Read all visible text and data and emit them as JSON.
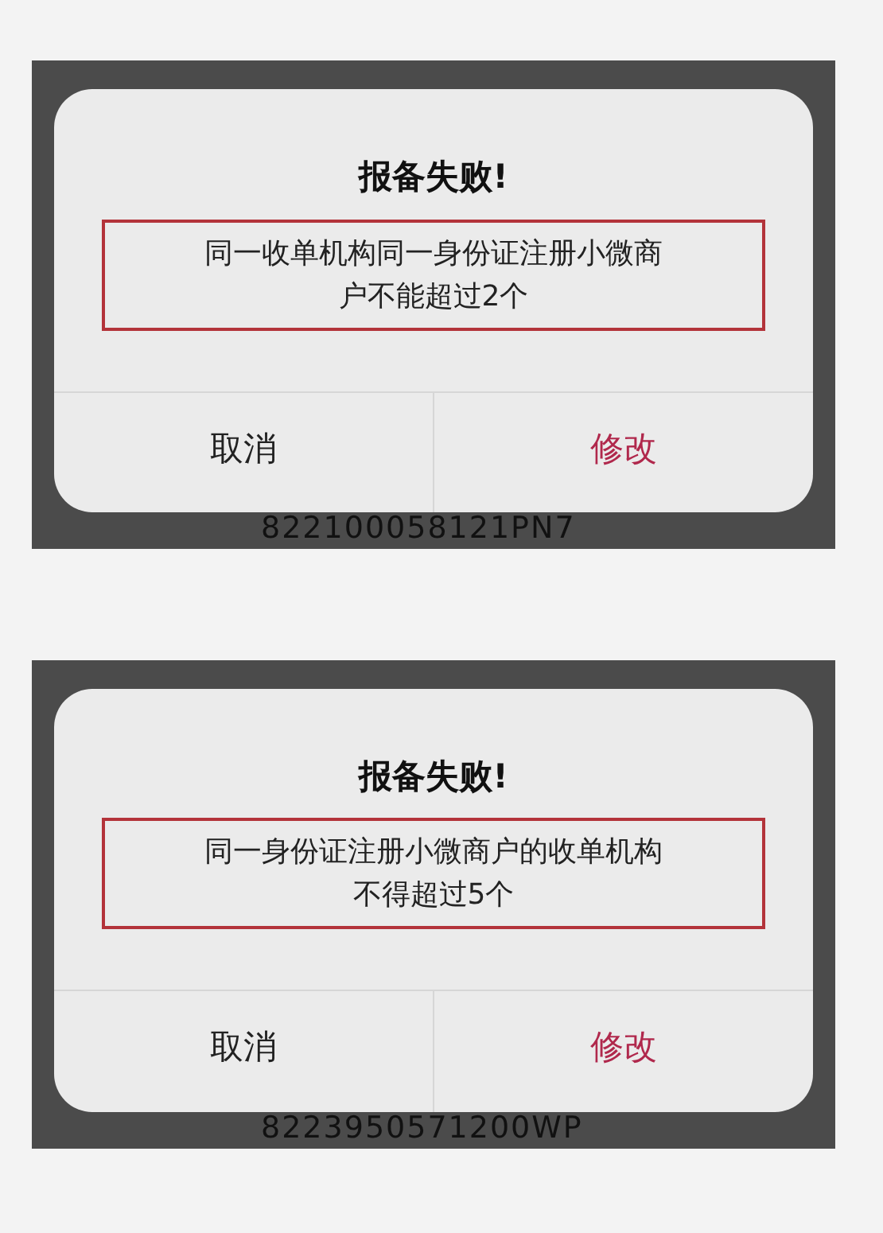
{
  "screens": [
    {
      "dialog": {
        "title": "报备失败!",
        "message_lines": [
          "同一收单机构同一身份证注册小微商",
          "户不能超过2个"
        ],
        "buttons": [
          {
            "label": "取消",
            "kind": "cancel"
          },
          {
            "label": "修改",
            "kind": "confirm"
          }
        ]
      },
      "background_text": "822100058121PN7"
    },
    {
      "dialog": {
        "title": "报备失败!",
        "message_lines": [
          "同一身份证注册小微商户的收单机构",
          "不得超过5个"
        ],
        "buttons": [
          {
            "label": "取消",
            "kind": "cancel"
          },
          {
            "label": "修改",
            "kind": "confirm"
          }
        ]
      },
      "background_text": "8223950571200WP"
    }
  ]
}
